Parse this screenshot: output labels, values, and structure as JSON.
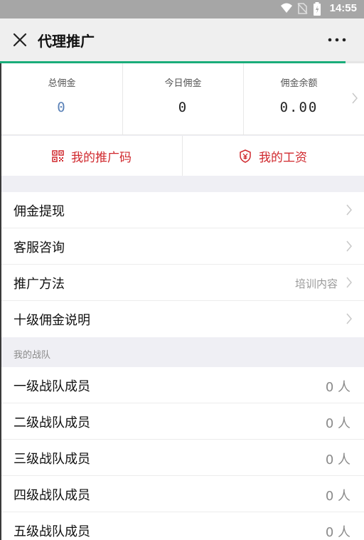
{
  "status_bar": {
    "time": "14:55",
    "icons": [
      "wifi-icon",
      "no-sim-icon",
      "battery-icon"
    ]
  },
  "header": {
    "title": "代理推广",
    "close_icon": "close-icon",
    "more_icon": "more-dots-icon",
    "load_progress": 0.95
  },
  "stats": [
    {
      "label": "总佣金",
      "value": "0"
    },
    {
      "label": "今日佣金",
      "value": "0"
    },
    {
      "label": "佣金余额",
      "value": "0.00"
    }
  ],
  "quick_actions": [
    {
      "label": "我的推广码",
      "icon": "qrcode-icon"
    },
    {
      "label": "我的工资",
      "icon": "yen-shield-icon"
    }
  ],
  "menu": [
    {
      "label": "佣金提现",
      "hint": ""
    },
    {
      "label": "客服咨询",
      "hint": ""
    },
    {
      "label": "推广方法",
      "hint": "培训内容"
    },
    {
      "label": "十级佣金说明",
      "hint": ""
    }
  ],
  "team_section": {
    "title": "我的战队"
  },
  "team": [
    {
      "label": "一级战队成员",
      "count": "0 人"
    },
    {
      "label": "二级战队成员",
      "count": "0 人"
    },
    {
      "label": "三级战队成员",
      "count": "0 人"
    },
    {
      "label": "四级战队成员",
      "count": "0 人"
    },
    {
      "label": "五级战队成员",
      "count": "0 人"
    }
  ],
  "colors": {
    "accent_red": "#d0292e",
    "progress_green": "#1aad7a",
    "value_blue": "#5b82b8"
  }
}
